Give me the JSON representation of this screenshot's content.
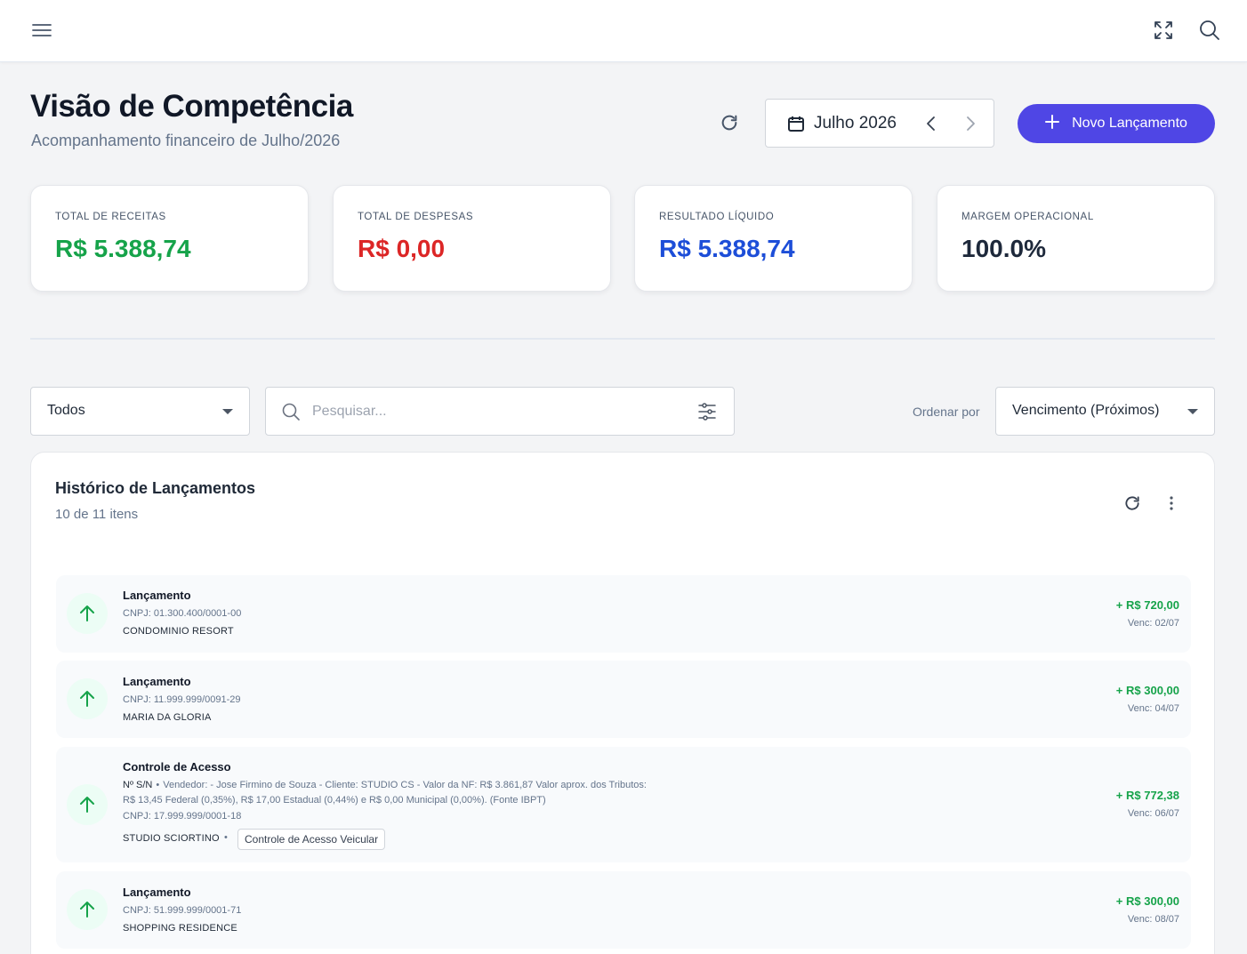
{
  "header": {
    "menu_icon": "menu-icon",
    "fullscreen_icon": "fullscreen-icon",
    "search_icon": "search-icon"
  },
  "page": {
    "title": "Visão de Competência",
    "subtitle": "Acompanhamento financeiro de Julho/2026",
    "month": "Julho 2026",
    "new_button": "Novo Lançamento"
  },
  "kpis": [
    {
      "label": "TOTAL DE RECEITAS",
      "value": "R$ 5.388,74",
      "color": "#16a34a"
    },
    {
      "label": "TOTAL DE DESPESAS",
      "value": "R$ 0,00",
      "color": "#dc2626"
    },
    {
      "label": "RESULTADO LÍQUIDO",
      "value": "R$ 5.388,74",
      "color": "#1d4ed8"
    },
    {
      "label": "MARGEM OPERACIONAL",
      "value": "100.0%",
      "color": "#1e293b"
    }
  ],
  "filters": {
    "type_value": "Todos",
    "search_placeholder": "Pesquisar...",
    "order_label": "Ordenar por",
    "order_value": "Vencimento (Próximos)"
  },
  "history": {
    "title": "Histórico de Lançamentos",
    "count": "10 de 11 itens",
    "items": [
      {
        "title": "Lançamento",
        "cnpj": "CNPJ: 01.300.400/0001-00",
        "party": "CONDOMINIO RESORT",
        "amount": "+ R$ 720,00",
        "due": "Venc: 02/07"
      },
      {
        "title": "Lançamento",
        "cnpj": "CNPJ: 11.999.999/0091-29",
        "party": "MARIA DA GLORIA",
        "amount": "+ R$ 300,00",
        "due": "Venc: 04/07"
      },
      {
        "title": "Controle de Acesso",
        "doc": "Nº S/N",
        "desc1": "Vendedor: - Jose Firmino de Souza - Cliente: STUDIO CS - Valor da NF: R$ 3.861,87 Valor aprox. dos Tributos:",
        "desc2": "R$ 13,45 Federal (0,35%), R$ 17,00 Estadual (0,44%) e R$ 0,00 Municipal (0,00%). (Fonte IBPT)",
        "cnpj": "CNPJ: 17.999.999/0001-18",
        "party": "STUDIO SCIORTINO",
        "tag": "Controle de Acesso Veicular",
        "amount": "+ R$ 772,38",
        "due": "Venc: 06/07"
      },
      {
        "title": "Lançamento",
        "cnpj": "CNPJ: 51.999.999/0001-71",
        "party": "SHOPPING RESIDENCE",
        "amount": "+ R$ 300,00",
        "due": "Venc: 08/07"
      }
    ]
  }
}
